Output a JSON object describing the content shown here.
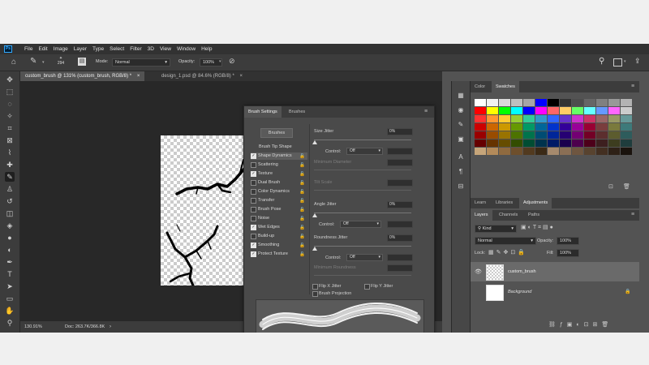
{
  "menubar": {
    "app_icon": "Ps",
    "items": [
      "File",
      "Edit",
      "Image",
      "Layer",
      "Type",
      "Select",
      "Filter",
      "3D",
      "View",
      "Window",
      "Help"
    ]
  },
  "options": {
    "brush_size": "294",
    "mode_label": "Mode:",
    "mode_value": "Normal",
    "opacity_label": "Opacity:",
    "opacity_value": "100%"
  },
  "tabs": [
    {
      "label": "custom_brush @ 131% (custom_brush, RGB/8) *",
      "active": true
    },
    {
      "label": "design_1.psd @ 84.6% (RGB/8) *",
      "active": false
    }
  ],
  "status": {
    "zoom": "130.91%",
    "doc": "Doc: 263.7K/366.8K"
  },
  "brush_panel": {
    "tabs": [
      "Brush Settings",
      "Brushes"
    ],
    "brushes_button": "Brushes",
    "tip_shape": "Brush Tip Shape",
    "options": [
      {
        "label": "Shape Dynamics",
        "checked": true
      },
      {
        "label": "Scattering",
        "checked": false
      },
      {
        "label": "Texture",
        "checked": true
      },
      {
        "label": "Dual Brush",
        "checked": false
      },
      {
        "label": "Color Dynamics",
        "checked": false
      },
      {
        "label": "Transfer",
        "checked": false
      },
      {
        "label": "Brush Pose",
        "checked": false
      },
      {
        "label": "Noise",
        "checked": false
      },
      {
        "label": "Wet Edges",
        "checked": true
      },
      {
        "label": "Build-up",
        "checked": false
      },
      {
        "label": "Smoothing",
        "checked": true
      },
      {
        "label": "Protect Texture",
        "checked": true
      }
    ],
    "size_jitter": {
      "label": "Size Jitter",
      "value": "0%"
    },
    "control_label": "Control:",
    "control_off": "Off",
    "minimum_diameter": "Minimum Diameter",
    "tilt_scale": "Tilt Scale",
    "angle_jitter": {
      "label": "Angle Jitter",
      "value": "0%"
    },
    "roundness_jitter": {
      "label": "Roundness Jitter",
      "value": "0%"
    },
    "minimum_roundness": "Minimum Roundness",
    "flip_x": "Flip X Jitter",
    "flip_y": "Flip Y Jitter",
    "brush_projection": "Brush Projection"
  },
  "swatches_panel": {
    "tabs": [
      "Color",
      "Swatches"
    ],
    "colors": [
      "#ffffff",
      "#f2f2f2",
      "#d9d9d9",
      "#bfbfbf",
      "#a6a6a6",
      "#0000ff",
      "#000000",
      "#333333",
      "#4d4d4d",
      "#666666",
      "#808080",
      "#999999",
      "#b3b3b3",
      "#ff0000",
      "#ffff00",
      "#00ff00",
      "#00ffff",
      "#0000ff",
      "#ff00ff",
      "#ff6666",
      "#ffcc66",
      "#66ff66",
      "#66ffff",
      "#6699ff",
      "#ff66ff",
      "#cccccc",
      "#ff3333",
      "#ff9933",
      "#ffcc33",
      "#99cc33",
      "#33cc99",
      "#3399cc",
      "#3366ff",
      "#6633cc",
      "#cc33cc",
      "#cc3366",
      "#996666",
      "#999966",
      "#669999",
      "#cc0000",
      "#cc6600",
      "#cc9900",
      "#669900",
      "#009966",
      "#006699",
      "#0033cc",
      "#330099",
      "#990099",
      "#990033",
      "#7a3d3d",
      "#7a7a3d",
      "#3d7a7a",
      "#990000",
      "#994c00",
      "#997300",
      "#4d7300",
      "#00734c",
      "#004c73",
      "#002699",
      "#260073",
      "#730073",
      "#730026",
      "#5c2e2e",
      "#5c5c2e",
      "#2e5c5c",
      "#660000",
      "#663300",
      "#664d00",
      "#334d00",
      "#004d33",
      "#00334d",
      "#001a66",
      "#1a004d",
      "#4d004d",
      "#4d001a",
      "#3d1f1f",
      "#3d3d1f",
      "#1f3d3d",
      "#c6a57a",
      "#b38a5a",
      "#8f6a3f",
      "#6e4f2c",
      "#523a1f",
      "#3b2a16",
      "#a68a6d",
      "#8a6f55",
      "#6f5640",
      "#58432f",
      "#432f21",
      "#2e2117",
      "#1a130d"
    ]
  },
  "adj_tabs": [
    "Learn",
    "Libraries",
    "Adjustments"
  ],
  "layers_panel": {
    "tabs": [
      "Layers",
      "Channels",
      "Paths"
    ],
    "kind": "Kind",
    "blend": "Normal",
    "opacity_label": "Opacity:",
    "opacity_value": "100%",
    "lock_label": "Lock:",
    "fill_label": "Fill:",
    "fill_value": "100%",
    "layers": [
      {
        "name": "custom_brush",
        "selected": true
      },
      {
        "name": "Background",
        "selected": false
      }
    ]
  }
}
